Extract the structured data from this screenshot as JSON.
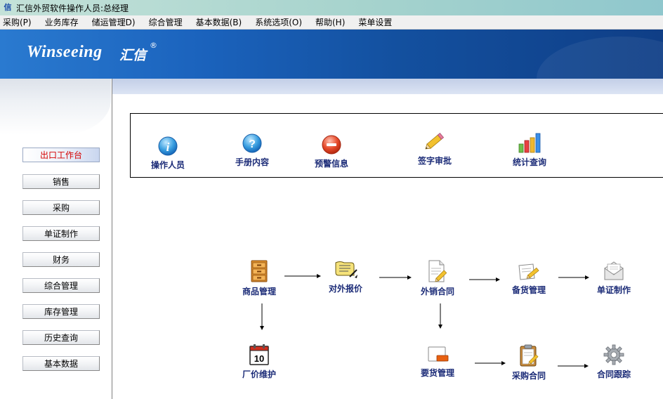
{
  "window": {
    "title": "汇信外贸软件操作人员:总经理",
    "app_icon": "信"
  },
  "menu": [
    {
      "label": "采购(P)"
    },
    {
      "label": "业务库存"
    },
    {
      "label": "储运管理D)"
    },
    {
      "label": "综合管理"
    },
    {
      "label": "基本数据(B)"
    },
    {
      "label": "系统选项(O)"
    },
    {
      "label": "帮助(H)"
    },
    {
      "label": "菜单设置"
    }
  ],
  "banner": {
    "logo_text": "Winseeing",
    "logo_cn": "汇信",
    "reg_mark": "®"
  },
  "sidebar": {
    "items": [
      {
        "label": "出口工作台",
        "active": true
      },
      {
        "label": "销售"
      },
      {
        "label": "采购"
      },
      {
        "label": "单证制作"
      },
      {
        "label": "财务"
      },
      {
        "label": "综合管理"
      },
      {
        "label": "库存管理"
      },
      {
        "label": "历史查询"
      },
      {
        "label": "基本数据"
      }
    ]
  },
  "toolbar": {
    "items": [
      {
        "label": "操作人员",
        "icon": "info-icon"
      },
      {
        "label": "手册内容",
        "icon": "help-icon"
      },
      {
        "label": "预警信息",
        "icon": "warning-icon"
      },
      {
        "label": "签字审批",
        "icon": "pencil-icon"
      },
      {
        "label": "统计查询",
        "icon": "bar-chart-icon"
      }
    ]
  },
  "workflow": {
    "nodes": {
      "product": {
        "label": "商品管理",
        "icon": "cabinet-icon"
      },
      "quote": {
        "label": "对外报价",
        "icon": "scroll-icon"
      },
      "sales_contract": {
        "label": "外销合同",
        "icon": "document-edit-icon"
      },
      "stock_prep": {
        "label": "备货管理",
        "icon": "note-edit-icon"
      },
      "documents": {
        "label": "单证制作",
        "icon": "envelope-icon"
      },
      "factory_price": {
        "label": "厂价维护",
        "icon": "calendar-icon"
      },
      "requisition": {
        "label": "要货管理",
        "icon": "tag-icon"
      },
      "purchase_contract": {
        "label": "采购合同",
        "icon": "clipboard-icon"
      },
      "tracking": {
        "label": "合同跟踪",
        "icon": "gear-icon"
      }
    }
  },
  "colors": {
    "banner": "#13509f",
    "label": "#1c2c78",
    "active_nav": "#d40000"
  }
}
